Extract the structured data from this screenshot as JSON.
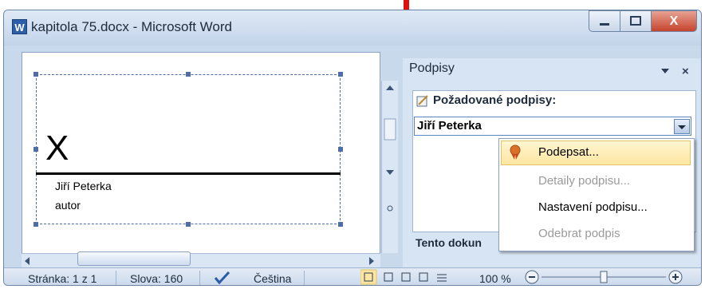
{
  "window": {
    "title": "kapitola 75.docx - Microsoft Word",
    "app_icon_letter": "W",
    "close_glyph": "X"
  },
  "document": {
    "signature_x": "X",
    "signer_name": "Jiří Peterka",
    "signer_title": "autor"
  },
  "panel": {
    "title": "Podpisy",
    "required_label": "Požadované podpisy:",
    "selected_signer": "Jiří Peterka",
    "section_label": "Tento dokun"
  },
  "menu": {
    "items": [
      {
        "label": "Podepsat...",
        "enabled": true,
        "highlighted": true
      },
      {
        "label": "Detaily podpisu...",
        "enabled": false
      },
      {
        "label": "Nastavení podpisu...",
        "enabled": true
      },
      {
        "label": "Odebrat podpis",
        "enabled": false
      }
    ]
  },
  "status": {
    "page": "Stránka: 1 z 1",
    "words": "Slova: 160",
    "language": "Čeština",
    "zoom": "100 %"
  },
  "colors": {
    "accent_red": "#e01010",
    "highlight": "#fde6a1"
  },
  "icons": [
    "word-app-icon",
    "minimize-icon",
    "maximize-icon",
    "close-icon",
    "signature-pen-icon",
    "dropdown-arrow-icon",
    "seal-ribbon-icon",
    "spellcheck-icon",
    "zoom-out-icon",
    "zoom-in-icon",
    "red-pointer-arrow-icon"
  ]
}
